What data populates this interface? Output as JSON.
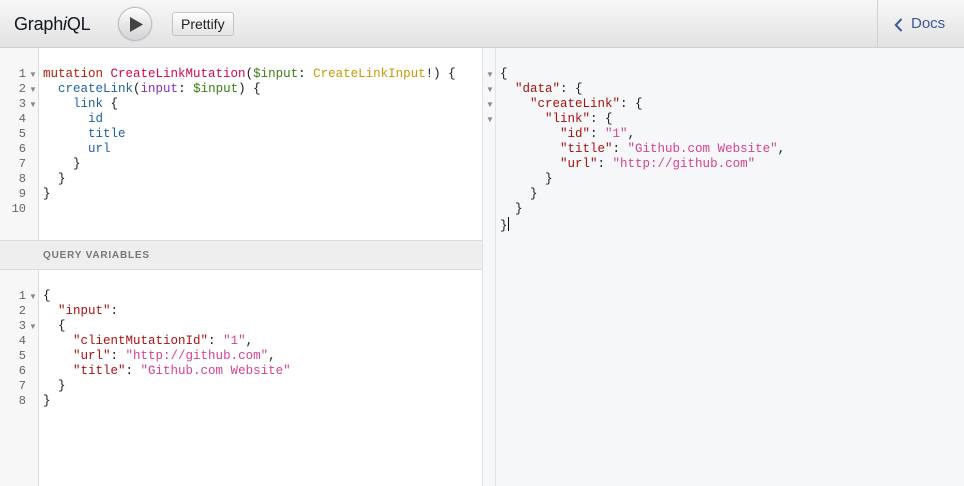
{
  "app": {
    "title_prefix": "Graph",
    "title_italic": "i",
    "title_suffix": "QL"
  },
  "toolbar": {
    "execute_icon": "play-icon",
    "prettify_label": "Prettify",
    "docs_label": "Docs",
    "docs_icon": "chevron-left-icon"
  },
  "query_editor": {
    "line_numbers": [
      "1",
      "2",
      "3",
      "4",
      "5",
      "6",
      "7",
      "8",
      "9",
      "10"
    ],
    "folded_lines": [
      1,
      2,
      3
    ],
    "lines": [
      [
        [
          "kw",
          "mutation"
        ],
        [
          "",
          " "
        ],
        [
          "def",
          "CreateLinkMutation"
        ],
        [
          "",
          "("
        ],
        [
          "var",
          "$input"
        ],
        [
          "",
          ": "
        ],
        [
          "ty",
          "CreateLinkInput"
        ],
        [
          "",
          "!) {"
        ]
      ],
      [
        [
          "",
          "  "
        ],
        [
          "pr",
          "createLink"
        ],
        [
          "",
          "("
        ],
        [
          "at",
          "input"
        ],
        [
          "",
          ": "
        ],
        [
          "var",
          "$input"
        ],
        [
          "",
          ") {"
        ]
      ],
      [
        [
          "",
          "    "
        ],
        [
          "pr",
          "link"
        ],
        [
          "",
          "",
          " {"
        ]
      ],
      [
        [
          "",
          "      "
        ],
        [
          "pr",
          "id"
        ]
      ],
      [
        [
          "",
          "      "
        ],
        [
          "pr",
          "title"
        ]
      ],
      [
        [
          "",
          "      "
        ],
        [
          "pr",
          "url"
        ]
      ],
      [
        [
          "",
          "    }"
        ]
      ],
      [
        [
          "",
          "  }"
        ]
      ],
      [
        [
          "",
          "}"
        ]
      ],
      [
        [
          "",
          ""
        ]
      ]
    ]
  },
  "variables": {
    "header": "QUERY VARIABLES",
    "line_numbers": [
      "1",
      "2",
      "3",
      "4",
      "5",
      "6",
      "7",
      "8"
    ],
    "folded_lines": [
      1,
      3
    ],
    "lines": [
      [
        [
          "",
          "{"
        ]
      ],
      [
        [
          "",
          "  "
        ],
        [
          "jkey",
          "\"input\""
        ],
        [
          "",
          ":"
        ]
      ],
      [
        [
          "",
          "  {"
        ]
      ],
      [
        [
          "",
          "    "
        ],
        [
          "jkey",
          "\"clientMutationId\""
        ],
        [
          "",
          ": "
        ],
        [
          "str",
          "\"1\""
        ],
        [
          "",
          ","
        ]
      ],
      [
        [
          "",
          "    "
        ],
        [
          "jkey",
          "\"url\""
        ],
        [
          "",
          ": "
        ],
        [
          "str",
          "\"http://github.com\""
        ],
        [
          "",
          ","
        ]
      ],
      [
        [
          "",
          "    "
        ],
        [
          "jkey",
          "\"title\""
        ],
        [
          "",
          ": "
        ],
        [
          "str",
          "\"Github.com Website\""
        ]
      ],
      [
        [
          "",
          "  }"
        ]
      ],
      [
        [
          "",
          "}"
        ]
      ]
    ]
  },
  "result": {
    "folded_lines": [
      1,
      2,
      3,
      4
    ],
    "lines": [
      [
        [
          "",
          "{"
        ]
      ],
      [
        [
          "",
          "  "
        ],
        [
          "jkey",
          "\"data\""
        ],
        [
          "",
          ": {"
        ]
      ],
      [
        [
          "",
          "    "
        ],
        [
          "jkey",
          "\"createLink\""
        ],
        [
          "",
          ": {"
        ]
      ],
      [
        [
          "",
          "      "
        ],
        [
          "jkey",
          "\"link\""
        ],
        [
          "",
          ": {"
        ]
      ],
      [
        [
          "",
          "        "
        ],
        [
          "jkey",
          "\"id\""
        ],
        [
          "",
          ": "
        ],
        [
          "str",
          "\"1\""
        ],
        [
          "",
          ","
        ]
      ],
      [
        [
          "",
          "        "
        ],
        [
          "jkey",
          "\"title\""
        ],
        [
          "",
          ": "
        ],
        [
          "str",
          "\"Github.com Website\""
        ],
        [
          "",
          ","
        ]
      ],
      [
        [
          "",
          "        "
        ],
        [
          "jkey",
          "\"url\""
        ],
        [
          "",
          ": "
        ],
        [
          "str",
          "\"http://github.com\""
        ]
      ],
      [
        [
          "",
          "      }"
        ]
      ],
      [
        [
          "",
          "    }"
        ]
      ],
      [
        [
          "",
          "  }"
        ]
      ],
      [
        [
          "",
          "}"
        ]
      ]
    ]
  }
}
